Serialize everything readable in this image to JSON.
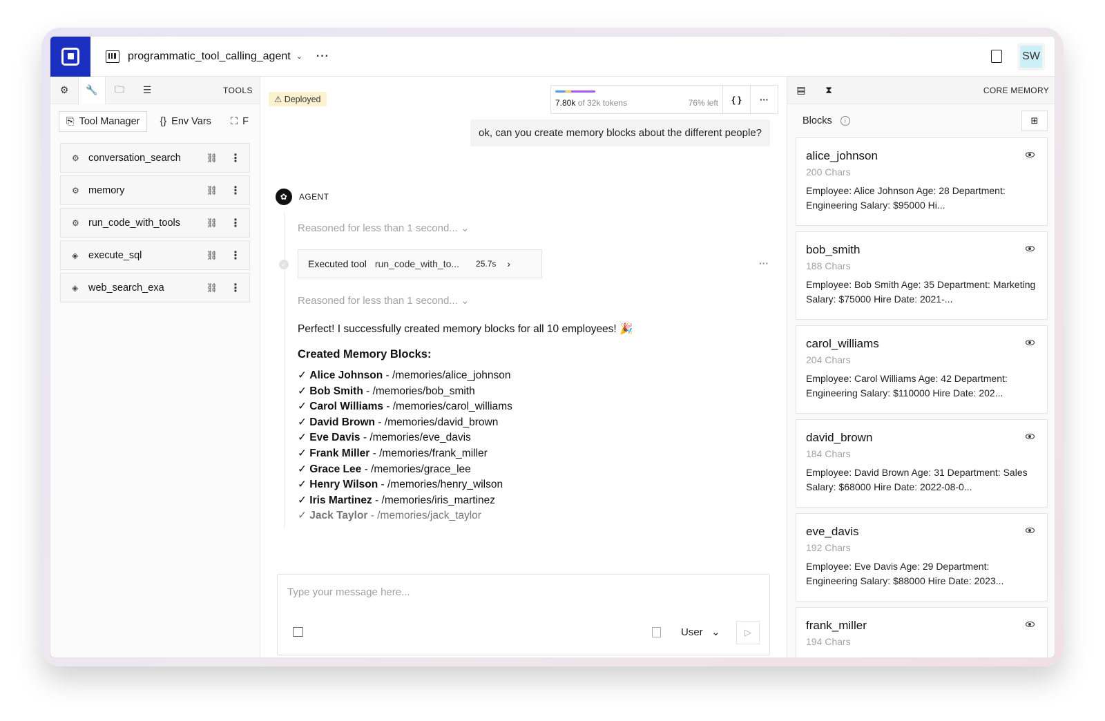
{
  "header": {
    "agent_name": "programmatic_tool_calling_agent",
    "more": "···",
    "avatar_initials": "SW"
  },
  "left_panel": {
    "title": "TOOLS",
    "subtabs": [
      {
        "label": "Tool Manager",
        "icon": "tool-manager-icon"
      },
      {
        "label": "Env Vars",
        "icon": "braces-icon"
      },
      {
        "label": "F",
        "icon": "diagram-icon"
      }
    ],
    "tools": [
      {
        "name": "conversation_search",
        "icon": "gear-icon"
      },
      {
        "name": "memory",
        "icon": "gear-icon"
      },
      {
        "name": "run_code_with_tools",
        "icon": "gear-icon"
      },
      {
        "name": "execute_sql",
        "icon": "diamond-icon"
      },
      {
        "name": "web_search_exa",
        "icon": "diamond-icon"
      }
    ]
  },
  "chat": {
    "deployed_label": "Deployed",
    "tokens": {
      "used": "7.80k",
      "of": "of 32k tokens",
      "left": "76% left"
    },
    "user_message": "ok, can you create memory blocks about the different people?",
    "agent_label": "AGENT",
    "reason_1": "Reasoned for less than 1 second...",
    "executed": {
      "label": "Executed tool",
      "tool": "run_code_with_to...",
      "time": "25.7s"
    },
    "reason_2": "Reasoned for less than 1 second...",
    "reply_intro": "Perfect! I successfully created memory blocks for all 10 employees! 🎉",
    "reply_heading": "Created Memory Blocks:",
    "items": [
      {
        "name": "Alice Johnson",
        "path": " - /memories/alice_johnson"
      },
      {
        "name": "Bob Smith",
        "path": " - /memories/bob_smith"
      },
      {
        "name": "Carol Williams",
        "path": " - /memories/carol_williams"
      },
      {
        "name": "David Brown",
        "path": " - /memories/david_brown"
      },
      {
        "name": "Eve Davis",
        "path": " - /memories/eve_davis"
      },
      {
        "name": "Frank Miller",
        "path": " - /memories/frank_miller"
      },
      {
        "name": "Grace Lee",
        "path": " - /memories/grace_lee"
      },
      {
        "name": "Henry Wilson",
        "path": " - /memories/henry_wilson"
      },
      {
        "name": "Iris Martinez",
        "path": " - /memories/iris_martinez"
      },
      {
        "name": "Jack Taylor",
        "path": " - /memories/jack_taylor"
      }
    ],
    "composer_placeholder": "Type your message here...",
    "role": "User"
  },
  "right_panel": {
    "title": "CORE MEMORY",
    "blocks_label": "Blocks",
    "blocks": [
      {
        "name": "alice_johnson",
        "chars": "200 Chars",
        "value": "Employee: Alice Johnson Age: 28 Department: Engineering Salary: $95000 Hi..."
      },
      {
        "name": "bob_smith",
        "chars": "188 Chars",
        "value": "Employee: Bob Smith Age: 35 Department: Marketing Salary: $75000 Hire Date: 2021-..."
      },
      {
        "name": "carol_williams",
        "chars": "204 Chars",
        "value": "Employee: Carol Williams Age: 42 Department: Engineering Salary: $110000 Hire Date: 202..."
      },
      {
        "name": "david_brown",
        "chars": "184 Chars",
        "value": "Employee: David Brown Age: 31 Department: Sales Salary: $68000 Hire Date: 2022-08-0..."
      },
      {
        "name": "eve_davis",
        "chars": "192 Chars",
        "value": "Employee: Eve Davis Age: 29 Department: Engineering Salary: $88000 Hire Date: 2023..."
      },
      {
        "name": "frank_miller",
        "chars": "194 Chars",
        "value": ""
      }
    ]
  }
}
